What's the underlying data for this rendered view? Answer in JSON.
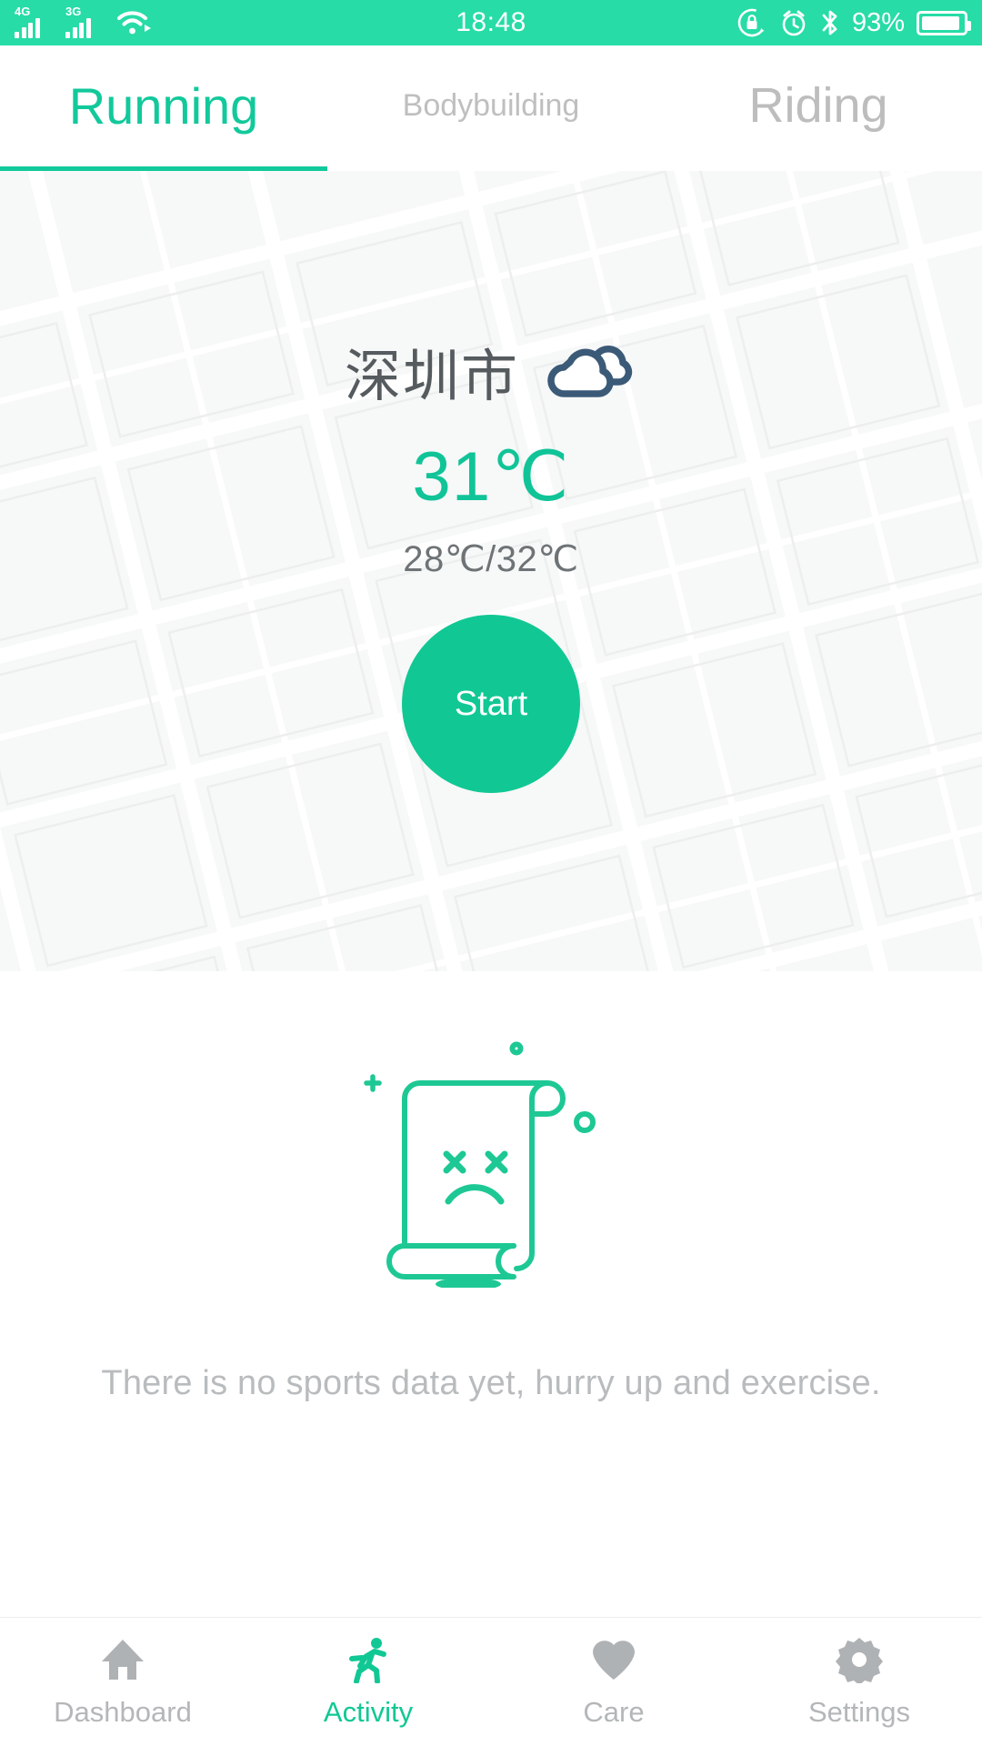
{
  "statusbar": {
    "clock": "18:48",
    "battery_percent": "93%",
    "sim1_network": "4G",
    "sim2_network": "3G",
    "icons": [
      "signal-4g-icon",
      "signal-3g-icon",
      "wifi-icon",
      "rotation-lock-icon",
      "alarm-icon",
      "bluetooth-icon",
      "battery-icon"
    ],
    "accent": "#27DCA7"
  },
  "tabs": {
    "items": [
      {
        "label": "Running",
        "active": true
      },
      {
        "label": "Bodybuilding",
        "active": false
      },
      {
        "label": "Riding",
        "active": false
      }
    ],
    "active_color": "#12C99B",
    "inactive_color": "#BDBDBD"
  },
  "weather": {
    "city": "深圳市",
    "condition_icon": "cloud-icon",
    "condition_color": "#3B5A78",
    "temperature": "31℃",
    "temperature_range": "28℃/32℃",
    "temp_color": "#10C498"
  },
  "start": {
    "label": "Start",
    "color": "#11C894"
  },
  "empty_state": {
    "illustration": "sad-scroll-icon",
    "illustration_color": "#1EC894",
    "message": "There is no sports data yet, hurry up and exercise."
  },
  "bottomnav": {
    "items": [
      {
        "label": "Dashboard",
        "icon": "home-icon",
        "active": false
      },
      {
        "label": "Activity",
        "icon": "running-person-icon",
        "active": true
      },
      {
        "label": "Care",
        "icon": "heart-icon",
        "active": false
      },
      {
        "label": "Settings",
        "icon": "gear-icon",
        "active": false
      }
    ],
    "active_color": "#11C894",
    "inactive_color": "#B4B7B9"
  }
}
